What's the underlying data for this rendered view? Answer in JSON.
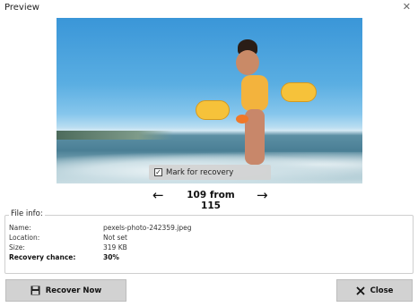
{
  "window": {
    "title": "Preview",
    "close_icon": "close-icon"
  },
  "preview": {
    "mark_label": "Mark for recovery",
    "mark_checked": true
  },
  "nav": {
    "prev_icon": "arrow-left-icon",
    "next_icon": "arrow-right-icon",
    "counter": "109 from 115"
  },
  "file_info": {
    "legend": "File info:",
    "rows": [
      {
        "label": "Name:",
        "value": "pexels-photo-242359.jpeg"
      },
      {
        "label": "Location:",
        "value": "Not set"
      },
      {
        "label": "Size:",
        "value": "319 KB"
      },
      {
        "label": "Recovery chance:",
        "value": "30%"
      }
    ]
  },
  "buttons": {
    "recover": "Recover Now",
    "recover_icon": "save-icon",
    "close": "Close",
    "close_icon": "x-icon"
  },
  "colors": {
    "button_bg": "#d2d2d2",
    "border": "#cfcfcf"
  }
}
